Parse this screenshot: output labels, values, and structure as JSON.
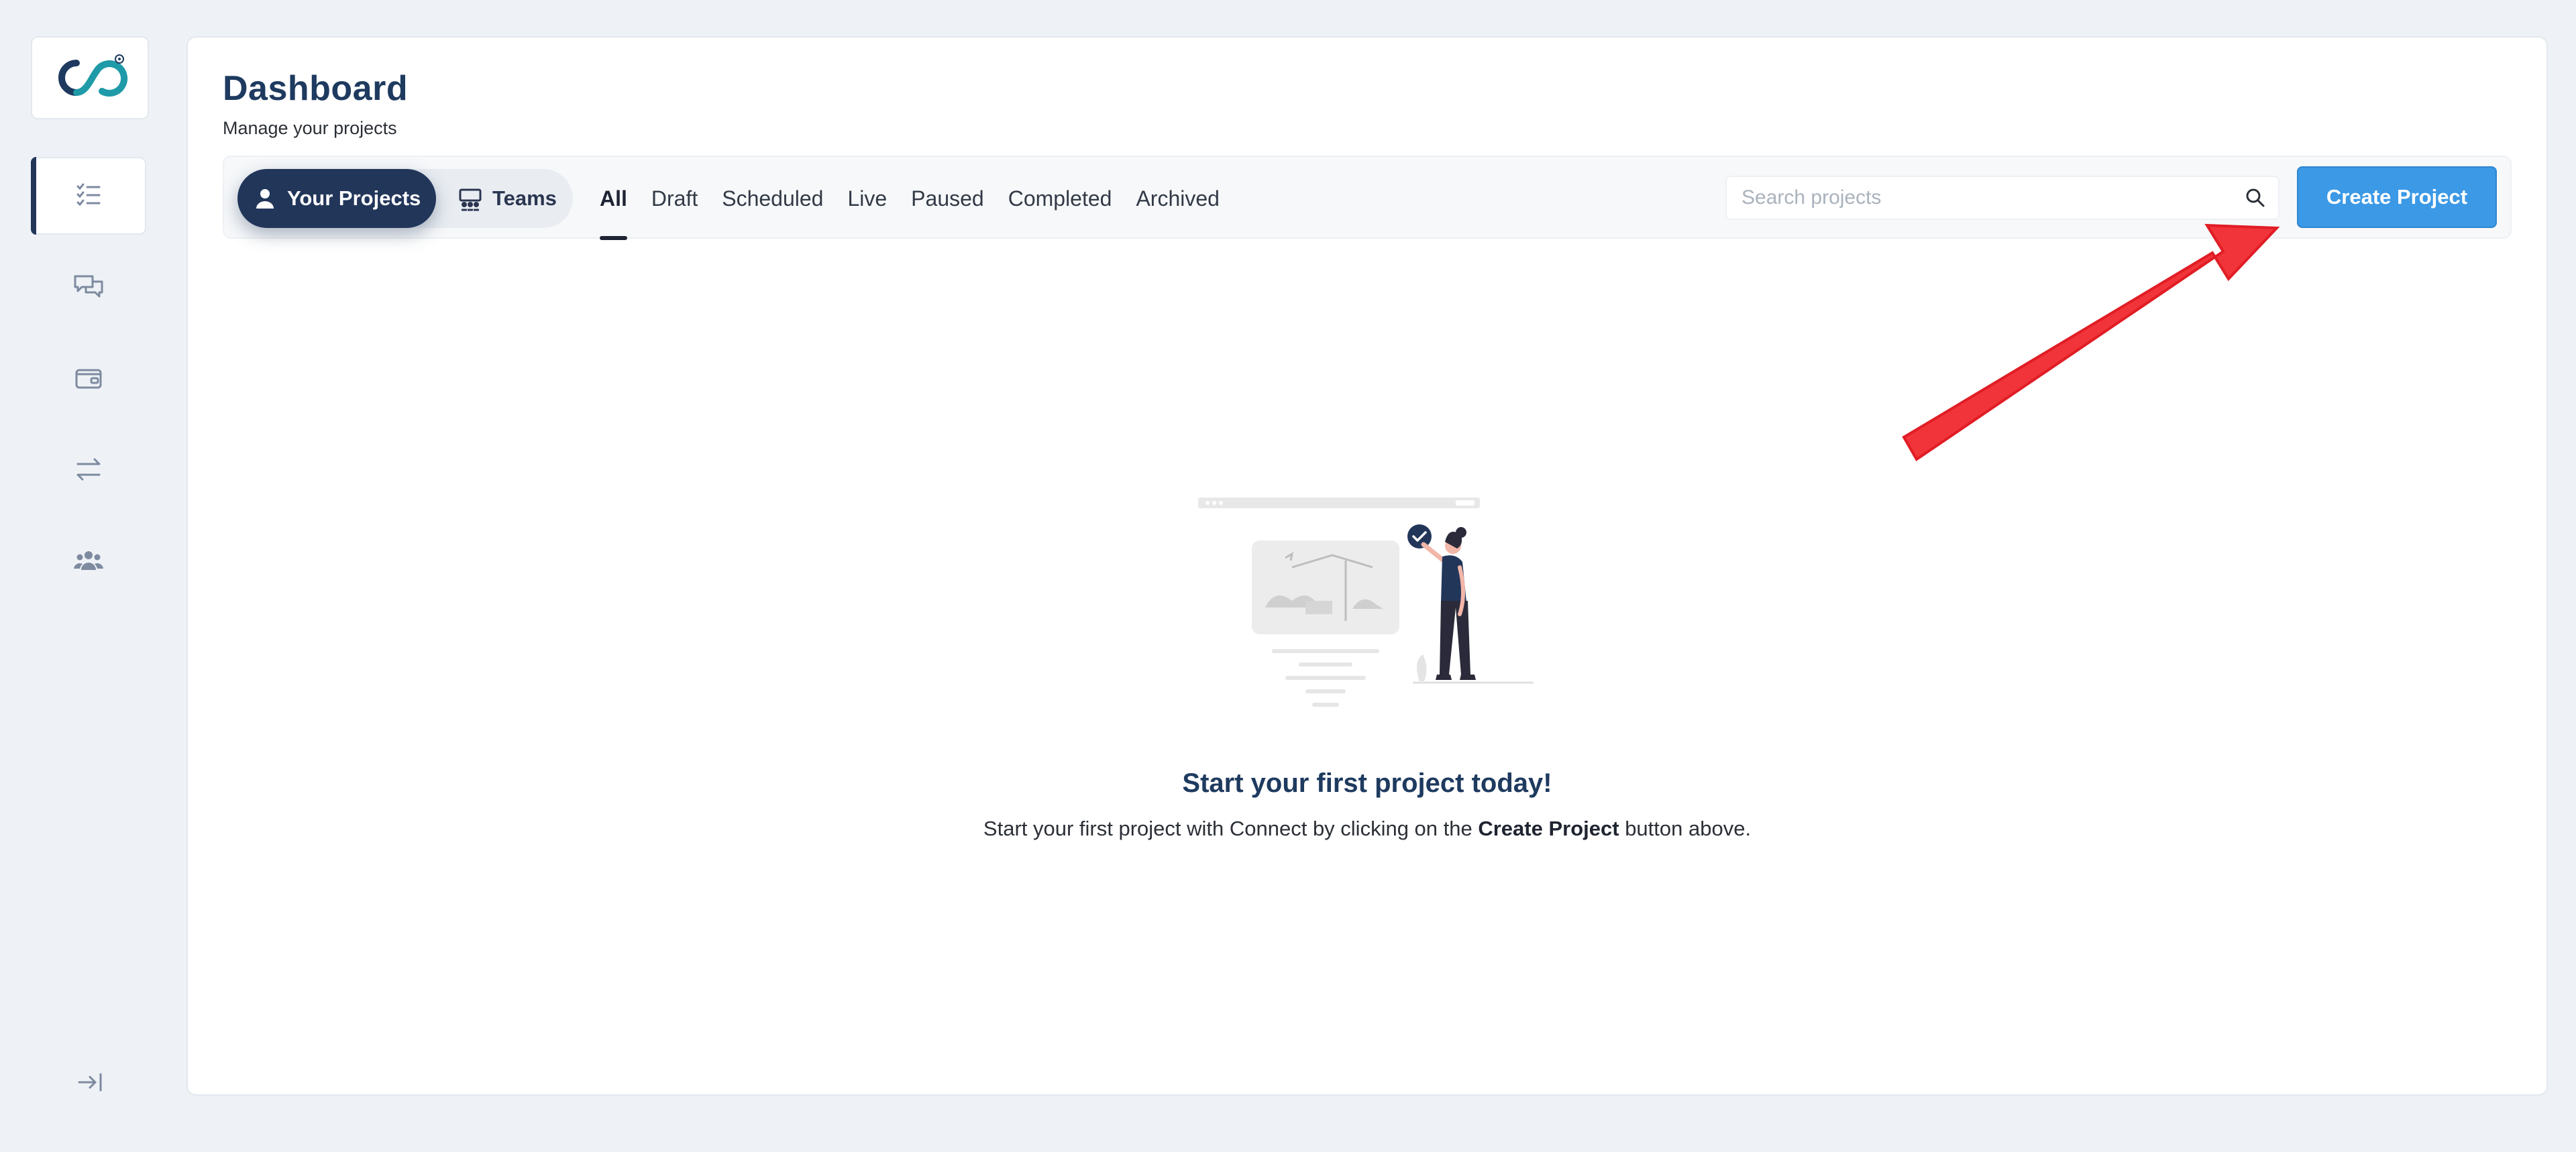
{
  "page": {
    "title": "Dashboard",
    "subtitle": "Manage your projects"
  },
  "sidebar": {
    "logo": "connect-logo",
    "items": [
      {
        "name": "projects",
        "icon": "checklist-icon",
        "active": true
      },
      {
        "name": "messages",
        "icon": "chat-bubbles-icon",
        "active": false
      },
      {
        "name": "wallet",
        "icon": "wallet-icon",
        "active": false
      },
      {
        "name": "transfers",
        "icon": "swap-arrows-icon",
        "active": false
      },
      {
        "name": "team",
        "icon": "users-group-icon",
        "active": false
      }
    ],
    "collapse_icon": "collapse-right-icon"
  },
  "toggle": {
    "your_projects": "Your Projects",
    "teams": "Teams"
  },
  "tabs": [
    "All",
    "Draft",
    "Scheduled",
    "Live",
    "Paused",
    "Completed",
    "Archived"
  ],
  "active_tab": "All",
  "search": {
    "placeholder": "Search projects",
    "value": ""
  },
  "create_button": "Create Project",
  "empty_state": {
    "title": "Start your first project today!",
    "desc_before": "Start your first project with Connect by clicking on the ",
    "desc_bold": "Create Project",
    "desc_after": " button above."
  },
  "colors": {
    "primary_navy": "#22365a",
    "title_blue": "#1e3a5f",
    "button_blue": "#3b99e6",
    "arrow_red": "#f0343a",
    "background": "#eef2f6"
  }
}
